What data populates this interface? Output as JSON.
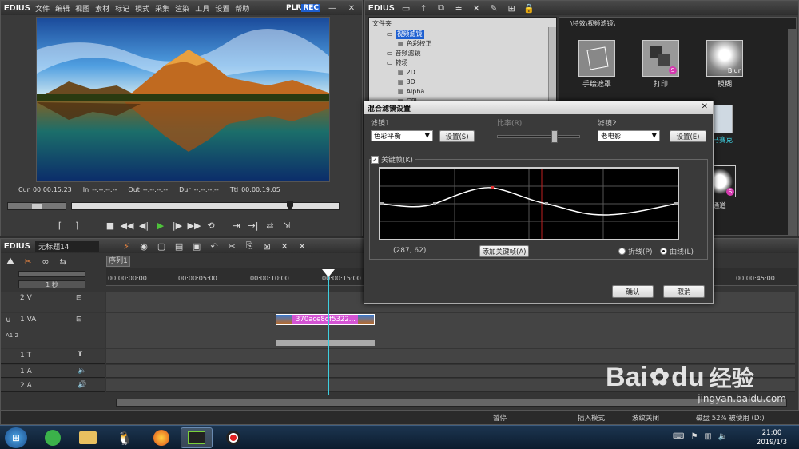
{
  "player": {
    "logo": "EDIUS",
    "menu": [
      "文件",
      "编辑",
      "视图",
      "素材",
      "标记",
      "模式",
      "采集",
      "渲染",
      "工具",
      "设置",
      "帮助"
    ],
    "plr": "PLR",
    "rec": "REC",
    "timecodes": {
      "cur_label": "Cur",
      "cur": "00:00:15:23",
      "in_label": "In",
      "in": "--:--:--:--",
      "out_label": "Out",
      "out": "--:--:--:--",
      "dur_label": "Dur",
      "dur": "--:--:--:--",
      "ttl_label": "Ttl",
      "ttl": "00:00:19:05"
    }
  },
  "palette": {
    "logo": "EDIUS",
    "folder_label": "文件夹",
    "tree": [
      {
        "label": "视频滤镜",
        "indent": 0,
        "selected": true
      },
      {
        "label": "色彩校正",
        "indent": 1
      },
      {
        "label": "音频滤镜",
        "indent": 0
      },
      {
        "label": "转场",
        "indent": 0
      },
      {
        "label": "2D",
        "indent": 1
      },
      {
        "label": "3D",
        "indent": 1
      },
      {
        "label": "Alpha",
        "indent": 1
      },
      {
        "label": "GPU",
        "indent": 1
      }
    ],
    "path": "\\特效\\视频滤镜\\",
    "effects": [
      {
        "label": "手绘遮罩"
      },
      {
        "label": "打印"
      },
      {
        "label": "模糊"
      },
      {
        "label": "马赛克"
      },
      {
        "label": "ha通道"
      }
    ],
    "blur_text": "Blur"
  },
  "dialog": {
    "title": "混合滤镜设置",
    "filter1_label": "滤镜1",
    "filter1_value": "色彩平衡",
    "settings1": "设置(S)",
    "ratio_label": "比率(R)",
    "filter2_label": "滤镜2",
    "filter2_value": "老电影",
    "settings2": "设置(E)",
    "keyframe_label": "关键帧(K)",
    "coords": "(287, 62)",
    "add_keyframe": "添加关键帧(A)",
    "polyline": "折线(P)",
    "curve": "曲线(L)",
    "ok": "确认",
    "cancel": "取消"
  },
  "timeline": {
    "logo": "EDIUS",
    "project": "无标题14",
    "sequence_tab": "序列1",
    "scale": "1 秒",
    "ruler": [
      "00:00:00:00",
      "00:00:05:00",
      "00:00:10:00",
      "00:00:15:00",
      "00:00:45:00"
    ],
    "tracks": [
      {
        "name": "2 V"
      },
      {
        "name": "1 VA"
      },
      {
        "name": "1 T"
      },
      {
        "name": "1 A"
      },
      {
        "name": "2 A"
      }
    ],
    "clip_name": "370ace8df5322...",
    "status": [
      "暂停",
      "插入模式",
      "波纹关闭",
      "磁盘 52% 被使用 (D:)"
    ]
  },
  "taskbar": {
    "time": "21:00",
    "date": "2019/1/3"
  },
  "watermark": {
    "brand": "Bai",
    "brand2": "du",
    "cn": "经验",
    "url": "jingyan.baidu.com"
  },
  "colors": {
    "accent_cyan": "#3ecfe0",
    "rec_blue": "#1e5fd0",
    "dialog_bg": "#3a3a3a",
    "clip_magenta": "#d454d4",
    "playhead_red": "#c02020"
  }
}
